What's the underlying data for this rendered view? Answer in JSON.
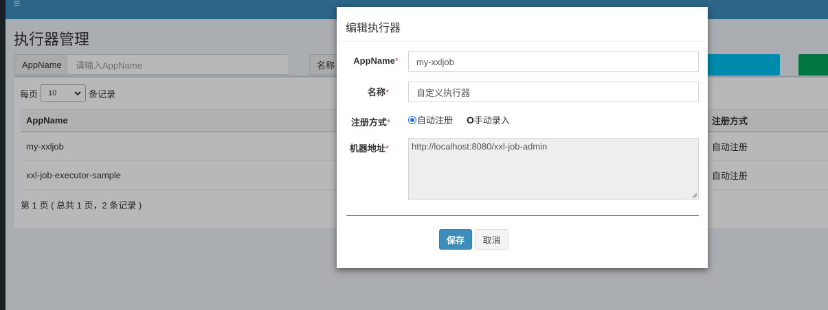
{
  "header": {
    "menu_icon": "≡"
  },
  "page": {
    "title": "执行器管理",
    "search": {
      "appname_label": "AppName",
      "appname_placeholder": "请输入AppName",
      "title_label": "名称"
    },
    "perpage": {
      "prefix": "每页",
      "value": "10",
      "suffix": "条记录"
    },
    "table": {
      "headers": [
        "AppName",
        "注册方式"
      ],
      "rows": [
        {
          "appname": "my-xxljob",
          "registry": "自动注册"
        },
        {
          "appname": "xxl-job-executor-sample",
          "registry": "自动注册"
        }
      ]
    },
    "pager": "第 1 页 ( 总共 1 页，2 条记录 )"
  },
  "modal": {
    "title": "编辑执行器",
    "appname_label": "AppName",
    "appname_value": "my-xxljob",
    "name_label": "名称",
    "name_value": "自定义执行器",
    "registry_label": "注册方式",
    "registry_auto": "自动注册",
    "registry_manual_marker": "O",
    "registry_manual": "手动录入",
    "address_label": "机器地址",
    "address_value": "http://localhost:8080/xxl-job-admin",
    "required_mark": "*",
    "save_label": "保存",
    "cancel_label": "取消"
  },
  "colors": {
    "topbar": "#3c8dbc",
    "primary": "#3c8dbc",
    "info": "#00c0ef",
    "success": "#00a65a",
    "required": "#dd4b39"
  }
}
